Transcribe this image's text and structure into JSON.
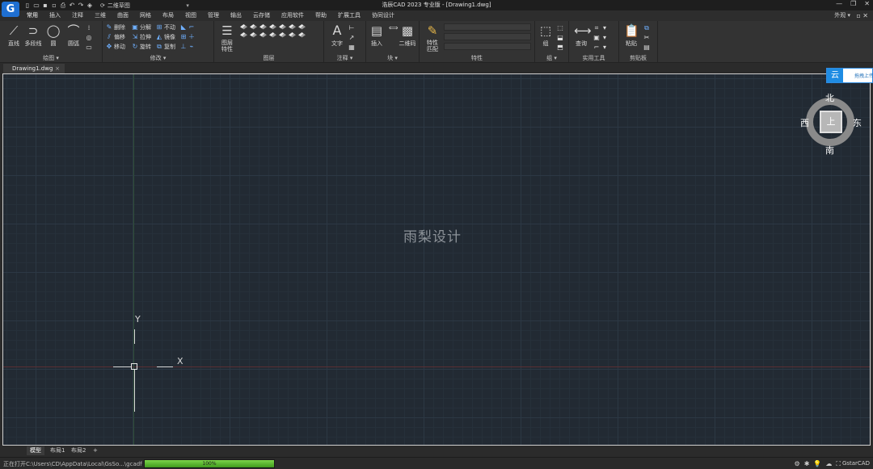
{
  "app": {
    "title": "浩辰CAD 2023 专业版 - [Drawing1.dwg]",
    "logo_letter": "G",
    "workspace": "二维草图",
    "window_controls": [
      "—",
      "❐",
      "✕"
    ]
  },
  "menu": {
    "items": [
      "常用",
      "插入",
      "注释",
      "三维",
      "曲面",
      "网格",
      "布局",
      "视图",
      "管理",
      "输出",
      "云存储",
      "应用软件",
      "帮助",
      "扩展工具",
      "协同设计"
    ],
    "active_index": 0,
    "appearance": "外观 ▾",
    "right_controls": "▫ ✕"
  },
  "ribbon": {
    "draw": {
      "label": "绘图 ▾",
      "buttons": [
        "直线",
        "多段线",
        "圆",
        "圆弧"
      ]
    },
    "modify": {
      "label": "修改 ▾",
      "col1": [
        "删除",
        "偏移",
        "移动"
      ],
      "col2": [
        "分解",
        "拉伸",
        "旋转"
      ],
      "col3": [
        "不动",
        "镜像",
        "复制"
      ]
    },
    "layers": {
      "label": "图层",
      "big_button": "图层\n特性"
    },
    "annotation": {
      "label": "注释 ▾",
      "big_button": "文字"
    },
    "block": {
      "label": "块 ▾",
      "buttons": [
        "插入",
        "二维码"
      ]
    },
    "properties": {
      "label": "特性",
      "big_button": "特性\n匹配"
    },
    "group": {
      "label": "组 ▾",
      "big_button": "组"
    },
    "utilities": {
      "label": "实用工具",
      "big_button": "查询"
    },
    "clipboard": {
      "label": "剪贴板",
      "big_button": "粘贴"
    }
  },
  "document_tab": {
    "label": "Drawing1.dwg",
    "close": "×"
  },
  "canvas": {
    "watermark": "雨梨设计",
    "ucs_x": "X",
    "ucs_y": "Y"
  },
  "viewcube": {
    "north": "北",
    "south": "南",
    "west": "西",
    "east": "东",
    "face": "上"
  },
  "cloud": {
    "icon": "云",
    "text": "拖拽上传"
  },
  "layout_tabs": [
    "模型",
    "布局1",
    "布局2",
    "+"
  ],
  "status": {
    "text": "正在打开C:\\Users\\CD\\AppData\\Local\\GsSo...\\gcadfile.ske",
    "progress_label": "100%",
    "progress": 100,
    "brand": "GstarCAD",
    "colors": {
      "progress": "#4fb52a",
      "accent": "#1f6fd1"
    }
  }
}
